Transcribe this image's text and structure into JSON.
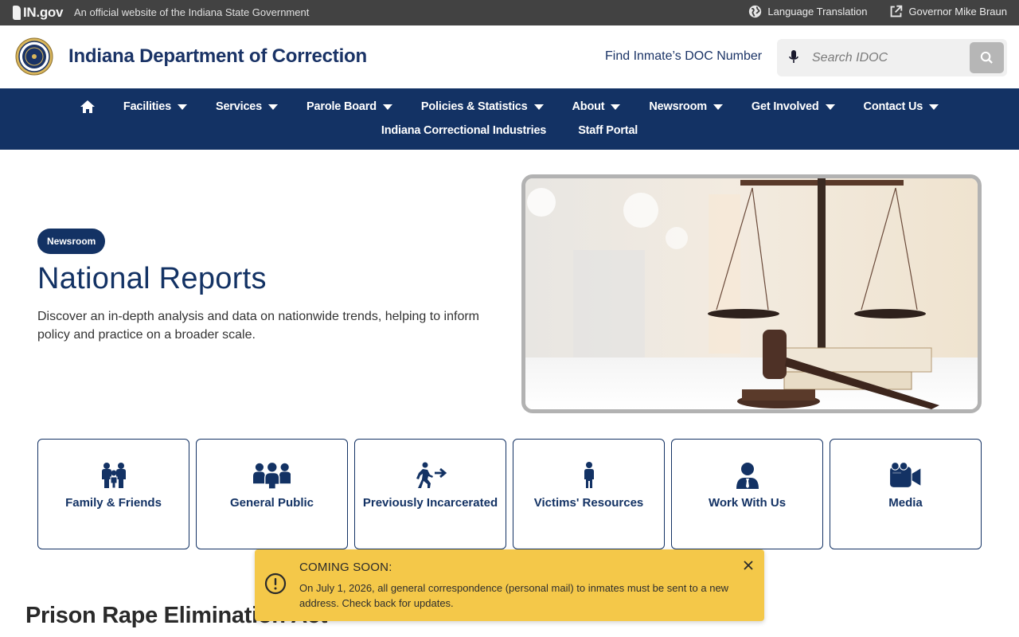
{
  "gov_bar": {
    "logo_text": "IN.gov",
    "official_text": "An official website of the Indiana State Government",
    "language_label": "Language Translation",
    "governor_label": "Governor Mike Braun"
  },
  "header": {
    "title": "Indiana Department of Correction",
    "find_inmate": "Find Inmate’s DOC Number",
    "search_placeholder": "Search IDOC"
  },
  "nav": {
    "row1": [
      {
        "label": "Facilities"
      },
      {
        "label": "Services"
      },
      {
        "label": "Parole Board"
      },
      {
        "label": "Policies & Statistics"
      },
      {
        "label": "About"
      },
      {
        "label": "Newsroom"
      },
      {
        "label": "Get Involved"
      },
      {
        "label": "Contact Us"
      }
    ],
    "row2": [
      {
        "label": "Indiana Correctional Industries"
      },
      {
        "label": "Staff Portal"
      }
    ]
  },
  "hero": {
    "tag": "Newsroom",
    "title": "National Reports",
    "description": "Discover an in-depth analysis and data on nationwide trends, helping to inform policy and practice on a broader scale."
  },
  "tiles": [
    {
      "label": "Family & Friends",
      "icon": "family-icon"
    },
    {
      "label": "General Public",
      "icon": "group-icon"
    },
    {
      "label": "Previously Incarcerated",
      "icon": "walking-arrow-icon"
    },
    {
      "label": "Victims' Resources",
      "icon": "person-icon"
    },
    {
      "label": "Work With Us",
      "icon": "user-tie-icon"
    },
    {
      "label": "Media",
      "icon": "video-camera-icon"
    }
  ],
  "section": {
    "prea_title": "Prison Rape Elimination Act"
  },
  "alert": {
    "title": "COMING SOON:",
    "body": "On July 1, 2026, all general correspondence (personal mail) to inmates must be sent to a new address. Check back for updates."
  },
  "colors": {
    "navy": "#133264",
    "gov_bar": "#424242",
    "alert": "#f4c849"
  }
}
